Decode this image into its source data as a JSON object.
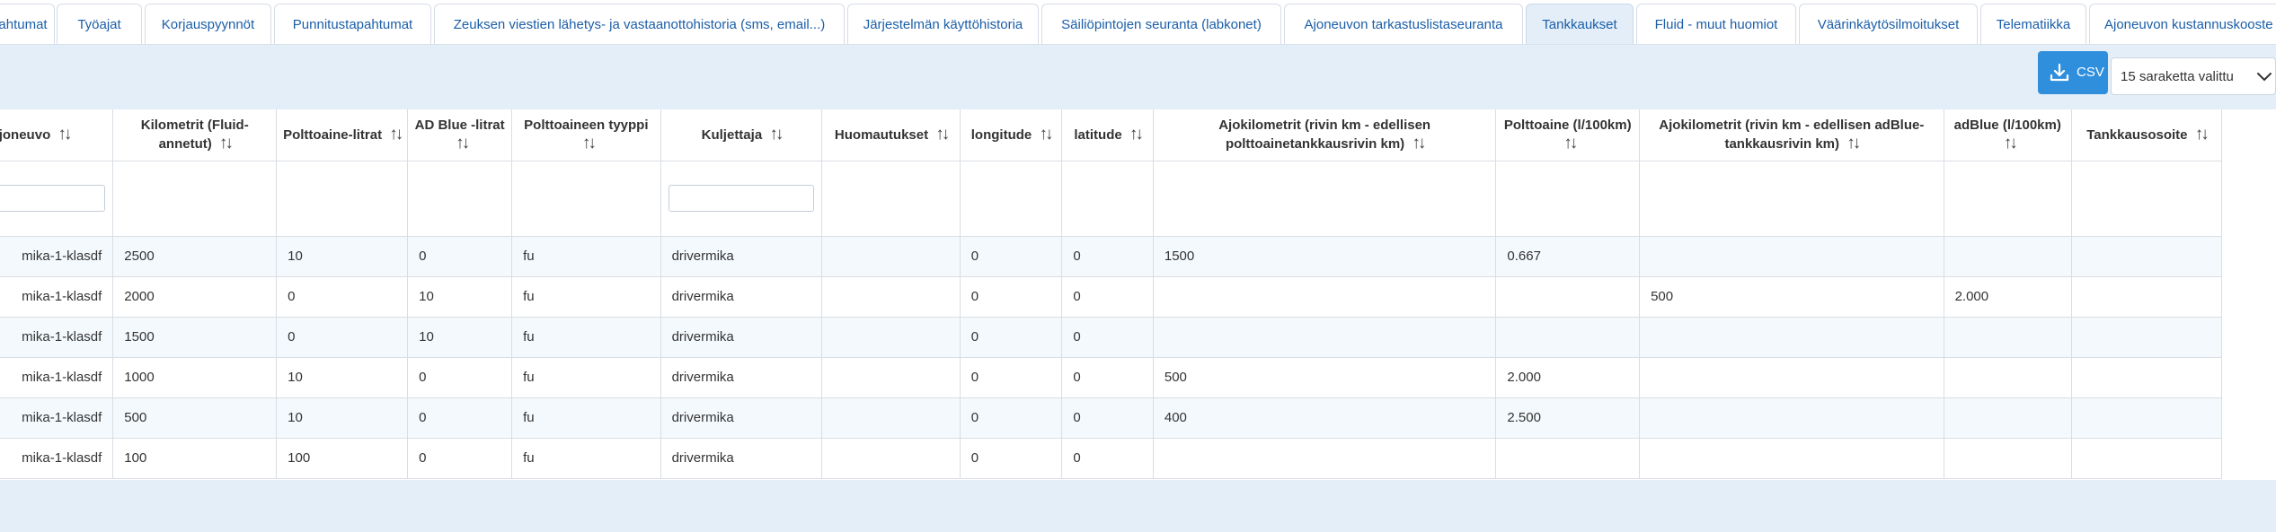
{
  "tabs": [
    {
      "label": "ahtumat",
      "active": false
    },
    {
      "label": "Työajat",
      "active": false
    },
    {
      "label": "Korjauspyynnöt",
      "active": false
    },
    {
      "label": "Punnitustapahtumat",
      "active": false
    },
    {
      "label": "Zeuksen viestien lähetys- ja vastaanottohistoria (sms, email...)",
      "active": false
    },
    {
      "label": "Järjestelmän käyttöhistoria",
      "active": false
    },
    {
      "label": "Säiliöpintojen seuranta (labkonet)",
      "active": false
    },
    {
      "label": "Ajoneuvon tarkastuslistaseuranta",
      "active": false
    },
    {
      "label": "Tankkaukset",
      "active": true
    },
    {
      "label": "Fluid - muut huomiot",
      "active": false
    },
    {
      "label": "Väärinkäytösilmoitukset",
      "active": false
    },
    {
      "label": "Telematiikka",
      "active": false
    },
    {
      "label": "Ajoneuvon kustannuskooste",
      "active": false
    }
  ],
  "toolbar": {
    "csv_label": "CSV",
    "columns_selected": "15 saraketta valittu"
  },
  "table": {
    "headers": [
      "Ajoneuvo",
      "Kilometrit (Fluid-annetut)",
      "Polttoaine-litrat",
      "AD Blue -litrat",
      "Polttoaineen tyyppi",
      "Kuljettaja",
      "Huomautukset",
      "longitude",
      "latitude",
      "Ajokilometrit (rivin km - edellisen polttoainetankkausrivin km)",
      "Polttoaine (l/100km)",
      "Ajokilometrit (rivin km - edellisen adBlue-tankkausrivin km)",
      "adBlue (l/100km)",
      "Tankkausosoite"
    ],
    "sort_icon": "↑↓",
    "filter_inputs": [
      0,
      5
    ],
    "rows": [
      [
        "mika-1-klasdf",
        "2500",
        "10",
        "0",
        "fu",
        "drivermika",
        "",
        "0",
        "0",
        "1500",
        "0.667",
        "",
        "",
        ""
      ],
      [
        "mika-1-klasdf",
        "2000",
        "0",
        "10",
        "fu",
        "drivermika",
        "",
        "0",
        "0",
        "",
        "",
        "500",
        "2.000",
        ""
      ],
      [
        "mika-1-klasdf",
        "1500",
        "0",
        "10",
        "fu",
        "drivermika",
        "",
        "0",
        "0",
        "",
        "",
        "",
        "",
        ""
      ],
      [
        "mika-1-klasdf",
        "1000",
        "10",
        "0",
        "fu",
        "drivermika",
        "",
        "0",
        "0",
        "500",
        "2.000",
        "",
        "",
        ""
      ],
      [
        "mika-1-klasdf",
        "500",
        "10",
        "0",
        "fu",
        "drivermika",
        "",
        "0",
        "0",
        "400",
        "2.500",
        "",
        "",
        ""
      ],
      [
        "mika-1-klasdf",
        "100",
        "100",
        "0",
        "fu",
        "drivermika",
        "",
        "0",
        "0",
        "",
        "",
        "",
        "",
        ""
      ]
    ]
  }
}
